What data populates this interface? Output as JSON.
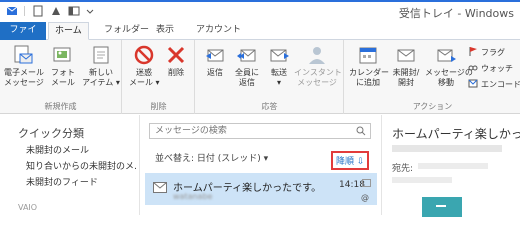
{
  "window": {
    "title": "受信トレイ - Windows"
  },
  "tabs": [
    {
      "label": "ファイル"
    },
    {
      "label": "ホーム"
    },
    {
      "label": "フォルダー"
    },
    {
      "label": "表示"
    },
    {
      "label": "アカウント"
    }
  ],
  "ribbon": {
    "new": {
      "label": "新規作成",
      "email": "電子メール\nメッセージ",
      "photo": "フォト\nメール",
      "item": "新しい\nアイテム ▾"
    },
    "delete": {
      "label": "削除",
      "junk": "迷惑\nメール ▾",
      "delete": "削除"
    },
    "respond": {
      "label": "応答",
      "reply": "返信",
      "reply_all": "全員に\n返信",
      "forward": "転送\n▾",
      "im": "インスタント\nメッセージ"
    },
    "actions": {
      "label": "アクション",
      "add_calendar": "カレンダー\nに追加",
      "unread": "未開封/\n開封",
      "move": "メッセージの\n移動",
      "flag": "フラグ",
      "watch": "ウォッチ",
      "encode": "エンコード"
    }
  },
  "sidebar": {
    "heading": "クイック分類",
    "items": [
      {
        "label": "未開封のメール"
      },
      {
        "label": "知り合いからの未開封のメ…"
      },
      {
        "label": "未開封のフィード"
      }
    ],
    "footer": "VAIO"
  },
  "message_list": {
    "search_placeholder": "メッセージの検索",
    "sort_label": "並べ替え: 日付 (スレッド) ▾",
    "order_label": "降順 ⇩",
    "messages": [
      {
        "subject": "ホームパーティ楽しかったです。",
        "time": "14:18",
        "from": "watanabe"
      }
    ]
  },
  "reader": {
    "title": "ホームパーティ楽しかっ",
    "to_label": "宛先:"
  },
  "colors": {
    "accent": "#1f6fc5",
    "selection": "#cde3f7",
    "highlight": "#e23b3b"
  }
}
